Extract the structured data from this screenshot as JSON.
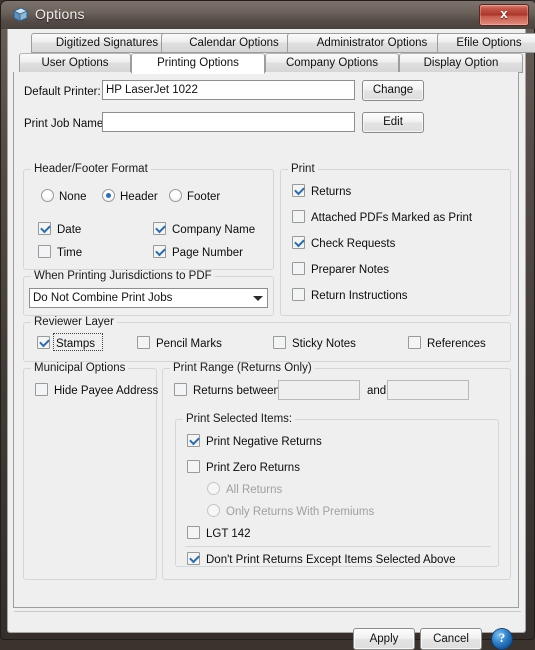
{
  "window": {
    "title": "Options",
    "icon": "printer-options-icon",
    "close_label": "x"
  },
  "tabs": {
    "row1": [
      {
        "label": "Digitized Signatures",
        "name": "tab-digitized-signatures"
      },
      {
        "label": "Calendar Options",
        "name": "tab-calendar-options"
      },
      {
        "label": "Administrator Options",
        "name": "tab-administrator-options"
      },
      {
        "label": "Efile Options",
        "name": "tab-efile-options"
      }
    ],
    "row2": [
      {
        "label": "User Options",
        "name": "tab-user-options"
      },
      {
        "label": "Printing Options",
        "name": "tab-printing-options",
        "active": true
      },
      {
        "label": "Company Options",
        "name": "tab-company-options"
      },
      {
        "label": "Display Option",
        "name": "tab-display-option"
      }
    ]
  },
  "printer": {
    "default_printer_label": "Default Printer:",
    "default_printer_value": "HP LaserJet 1022",
    "change_button": "Change",
    "print_job_label": "Print Job Name:",
    "print_job_value": "",
    "print_job_placeholder": "",
    "edit_button": "Edit"
  },
  "header_footer": {
    "title": "Header/Footer Format",
    "radios": [
      {
        "label": "None",
        "checked": false
      },
      {
        "label": "Header",
        "checked": true
      },
      {
        "label": "Footer",
        "checked": false
      }
    ],
    "checks": [
      {
        "label": "Date",
        "checked": true
      },
      {
        "label": "Company Name",
        "checked": true
      },
      {
        "label": "Time",
        "checked": false
      },
      {
        "label": "Page Number",
        "checked": true
      }
    ]
  },
  "jurisdictions": {
    "title": "When Printing Jurisdictions to PDF",
    "selected": "Do Not Combine Print Jobs"
  },
  "print": {
    "title": "Print",
    "items": [
      {
        "label": "Returns",
        "checked": true
      },
      {
        "label": "Attached PDFs Marked as Print",
        "checked": false
      },
      {
        "label": "Check Requests",
        "checked": true
      },
      {
        "label": "Preparer Notes",
        "checked": false
      },
      {
        "label": "Return Instructions",
        "checked": false
      }
    ]
  },
  "reviewer_layer": {
    "title": "Reviewer Layer",
    "items": [
      {
        "label": "Stamps",
        "checked": true,
        "focused": true
      },
      {
        "label": "Pencil Marks",
        "checked": false
      },
      {
        "label": "Sticky Notes",
        "checked": false
      },
      {
        "label": "References",
        "checked": false
      }
    ]
  },
  "municipal": {
    "title": "Municipal Options",
    "items": [
      {
        "label": "Hide Payee Address",
        "checked": false
      }
    ]
  },
  "print_range": {
    "title": "Print Range (Returns Only)",
    "returns_between_label": "Returns between",
    "returns_between_checked": false,
    "from_value": "",
    "and_label": "and",
    "to_value": "",
    "selected_items": {
      "title": "Print Selected Items:",
      "print_negative_returns": {
        "label": "Print Negative Returns",
        "checked": true
      },
      "print_zero_returns": {
        "label": "Print Zero Returns",
        "checked": false
      },
      "zero_radios": [
        {
          "label": "All Returns",
          "checked": false,
          "disabled": true
        },
        {
          "label": "Only Returns With Premiums",
          "checked": false,
          "disabled": true
        }
      ],
      "lgt": {
        "label": "LGT 142",
        "checked": false
      },
      "dont_print": {
        "label": "Don't Print Returns Except Items Selected Above",
        "checked": true
      }
    }
  },
  "footer": {
    "apply_button": "Apply",
    "cancel_button": "Cancel",
    "help_button": "?"
  },
  "colors": {
    "accent_check": "#2f6ba6",
    "close_red": "#a83528",
    "help_blue": "#2e7ec6",
    "panel_bg": "#efefef"
  }
}
